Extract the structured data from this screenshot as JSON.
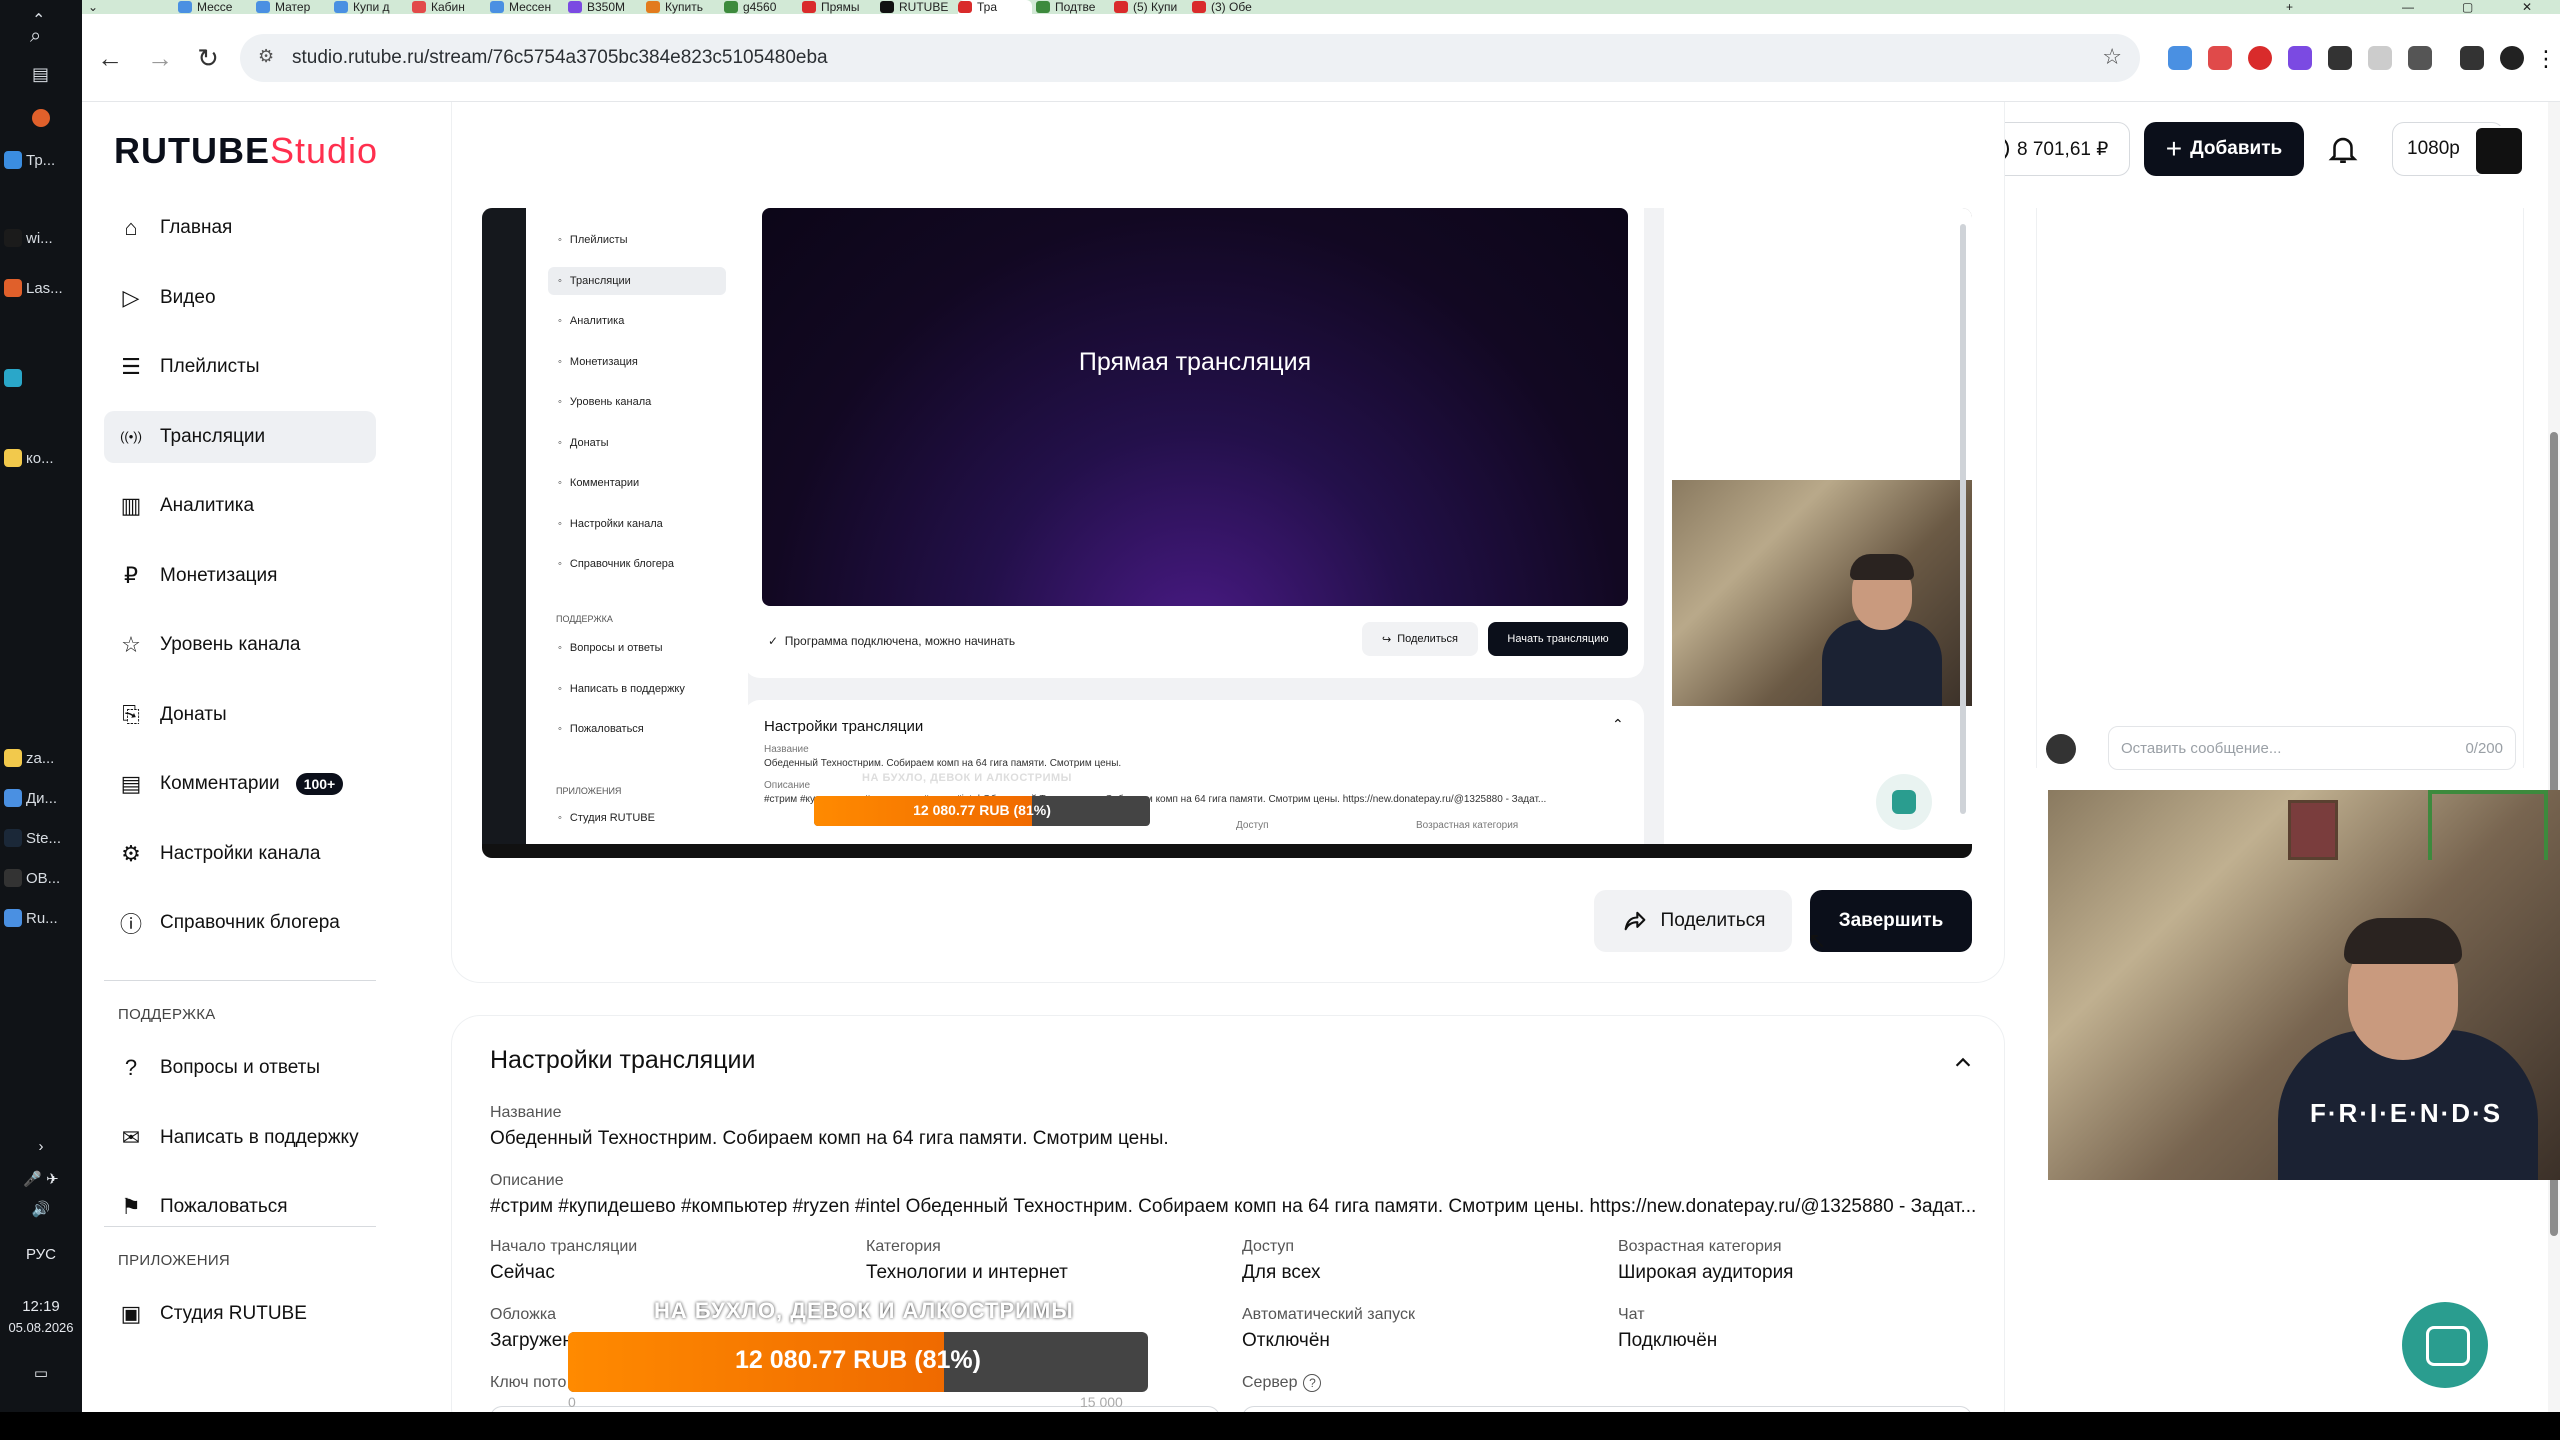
{
  "taskbar": {
    "items": [
      {
        "label": "Тр...",
        "color": "#3b8de0"
      },
      {
        "label": "wi...",
        "color": "#1b1b1b"
      },
      {
        "label": "Las...",
        "color": "#e0602b"
      },
      {
        "label": "",
        "color": "#2aa7c9"
      },
      {
        "label": "ко...",
        "color": "#f2c94c"
      },
      {
        "label": "za...",
        "color": "#f2c94c"
      },
      {
        "label": "Ди...",
        "color": "#4a90e2"
      },
      {
        "label": "Ste...",
        "color": "#1b2838"
      },
      {
        "label": "OB...",
        "color": "#333"
      },
      {
        "label": "Ru...",
        "color": "#4a90e2"
      }
    ],
    "lang": "РУС",
    "time": "12:19",
    "date": "05.08.2026"
  },
  "browser": {
    "tabs": [
      "Мессе",
      "Матер",
      "Купи д",
      "Кабин",
      "Мессен",
      "B350M",
      "Купить",
      "g4560",
      "Прямы",
      "RUTUBE",
      "Тра",
      "Подтве",
      "(5) Купи",
      "(3) Обе"
    ],
    "url": "studio.rutube.ru/stream/76c5754a3705bc384e823c5105480eba"
  },
  "logo": {
    "main": "RUTUBE",
    "sub": "Studio"
  },
  "header": {
    "balance": "8 701,61 ₽",
    "add_label": "Добавить",
    "quality": "1080p"
  },
  "sidebar": {
    "items": [
      {
        "label": "Главная",
        "icon": "home-icon"
      },
      {
        "label": "Видео",
        "icon": "video-icon"
      },
      {
        "label": "Плейлисты",
        "icon": "playlist-icon"
      },
      {
        "label": "Трансляции",
        "icon": "broadcast-icon",
        "active": true
      },
      {
        "label": "Аналитика",
        "icon": "analytics-icon"
      },
      {
        "label": "Монетизация",
        "icon": "ruble-icon"
      },
      {
        "label": "Уровень канала",
        "icon": "star-icon"
      },
      {
        "label": "Донаты",
        "icon": "gift-icon"
      },
      {
        "label": "Комментарии",
        "icon": "comment-icon",
        "badge": "100+"
      },
      {
        "label": "Настройки канала",
        "icon": "gear-icon"
      },
      {
        "label": "Справочник блогера",
        "icon": "info-icon"
      }
    ],
    "support_title": "ПОДДЕРЖКА",
    "support_items": [
      {
        "label": "Вопросы и ответы",
        "icon": "question-icon"
      },
      {
        "label": "Написать в поддержку",
        "icon": "mail-icon"
      },
      {
        "label": "Пожаловаться",
        "icon": "flag-icon"
      }
    ],
    "apps_title": "ПРИЛОЖЕНИЯ",
    "apps_items": [
      {
        "label": "Студия RUTUBE",
        "icon": "studio-icon"
      }
    ]
  },
  "preview": {
    "nav_items": [
      "Плейлисты",
      "Трансляции",
      "Аналитика",
      "Монетизация",
      "Уровень канала",
      "Донаты",
      "Комментарии",
      "Настройки канала",
      "Справочник блогера"
    ],
    "support_title": "ПОДДЕРЖКА",
    "support_items": [
      "Вопросы и ответы",
      "Написать в поддержку",
      "Пожаловаться"
    ],
    "apps_title": "ПРИЛОЖЕНИЯ",
    "apps_items": [
      "Студия RUTUBE"
    ],
    "video_title": "Прямая трансляция",
    "status": "Программа подключена, можно начинать",
    "share_label": "Поделиться",
    "start_label": "Начать трансляцию",
    "settings_title": "Настройки трансляции",
    "name_label": "Название",
    "name_value": "Обеденный Техностнрим. Собираем комп на 64 гига памяти. Смотрим цены.",
    "desc_label": "Описание",
    "desc_value": "#стрим #купидешево #компьютер #ryzen #intel Обеденный Техностнрим. Собираем комп на 64 гига памяти. Смотрим цены. https://new.donatepay.ru/@1325880 - Задат...",
    "access_label": "Доступ",
    "age_label": "Возрастная категория",
    "donate_caption": "НА БУХЛО, ДЕВОК И АЛКОСТРИМЫ",
    "donate_text": "12 080.77 RUB (81%)",
    "donate_progress": 0.81
  },
  "actions": {
    "share_label": "Поделиться",
    "finish_label": "Завершить"
  },
  "settings": {
    "title": "Настройки трансляции",
    "name_label": "Название",
    "name_value": "Обеденный Техностнрим. Собираем комп на 64 гига памяти. Смотрим цены.",
    "desc_label": "Описание",
    "desc_value": "#стрим #купидешево #компьютер #ryzen #intel Обеденный Техностнрим. Собираем комп на 64 гига памяти. Смотрим цены. https://new.donatepay.ru/@1325880 - Задат...",
    "start_label": "Начало трансляции",
    "start_value": "Сейчас",
    "category_label": "Категория",
    "category_value": "Технологии и интернет",
    "access_label": "Доступ",
    "access_value": "Для всех",
    "age_label": "Возрастная категория",
    "age_value": "Широкая аудитория",
    "cover_label": "Обложка",
    "cover_value": "Загружен",
    "autostart_label": "Автоматический запуск",
    "autostart_value": "Отключён",
    "chat_label": "Чат",
    "chat_value": "Подключён",
    "key_label": "Ключ пото",
    "server_label": "Сервер"
  },
  "donation": {
    "caption": "НА БУХЛО, ДЕВОК И АЛКОСТРИМЫ",
    "text": "12 080.77 RUB (81%)",
    "progress": 0.81,
    "min": "0",
    "max": "15 000"
  },
  "chat": {
    "placeholder": "Оставить сообщение...",
    "counter": "0/200"
  },
  "webcam": {
    "shirt_text": "F·R·I·E·N·D·S"
  }
}
